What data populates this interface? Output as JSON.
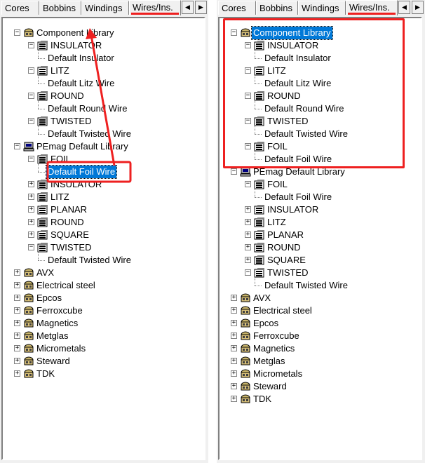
{
  "tabs": [
    {
      "label": "Cores",
      "active": false
    },
    {
      "label": "Bobbins",
      "active": false
    },
    {
      "label": "Windings",
      "active": false
    },
    {
      "label": "Wires/Ins.",
      "active": true
    }
  ],
  "icons": {
    "scroll_left": "scroll-left-arrow",
    "scroll_right": "scroll-right-arrow"
  },
  "colors": {
    "highlight": "#ee2020",
    "selection": "#0078d7"
  },
  "left_tree": [
    {
      "level": 0,
      "label": "Component Library",
      "icon": "library-icon",
      "toggle": "-"
    },
    {
      "level": 1,
      "label": "INSULATOR",
      "icon": "folder-icon",
      "toggle": "-"
    },
    {
      "level": 2,
      "label": "Default Insulator"
    },
    {
      "level": 1,
      "label": "LITZ",
      "icon": "folder-icon",
      "toggle": "-"
    },
    {
      "level": 2,
      "label": "Default Litz Wire"
    },
    {
      "level": 1,
      "label": "ROUND",
      "icon": "folder-icon",
      "toggle": "-"
    },
    {
      "level": 2,
      "label": "Default Round Wire"
    },
    {
      "level": 1,
      "label": "TWISTED",
      "icon": "folder-icon",
      "toggle": "-"
    },
    {
      "level": 2,
      "label": "Default Twisted Wire"
    },
    {
      "level": 0,
      "label": "PEmag Default Library",
      "icon": "computer-icon",
      "toggle": "-"
    },
    {
      "level": 1,
      "label": "FOIL",
      "icon": "folder-icon",
      "toggle": "-"
    },
    {
      "level": 2,
      "label": "Default Foil Wire",
      "selected": true
    },
    {
      "level": 1,
      "label": "INSULATOR",
      "icon": "folder-icon",
      "toggle": "+"
    },
    {
      "level": 1,
      "label": "LITZ",
      "icon": "folder-icon",
      "toggle": "+"
    },
    {
      "level": 1,
      "label": "PLANAR",
      "icon": "folder-icon",
      "toggle": "+"
    },
    {
      "level": 1,
      "label": "ROUND",
      "icon": "folder-icon",
      "toggle": "+"
    },
    {
      "level": 1,
      "label": "SQUARE",
      "icon": "folder-icon",
      "toggle": "+"
    },
    {
      "level": 1,
      "label": "TWISTED",
      "icon": "folder-icon",
      "toggle": "-"
    },
    {
      "level": 2,
      "label": "Default Twisted Wire"
    },
    {
      "level": 0,
      "label": "AVX",
      "icon": "library-icon",
      "toggle": "+"
    },
    {
      "level": 0,
      "label": "Electrical steel",
      "icon": "library-icon",
      "toggle": "+"
    },
    {
      "level": 0,
      "label": "Epcos",
      "icon": "library-icon",
      "toggle": "+"
    },
    {
      "level": 0,
      "label": "Ferroxcube",
      "icon": "library-icon",
      "toggle": "+"
    },
    {
      "level": 0,
      "label": "Magnetics",
      "icon": "library-icon",
      "toggle": "+"
    },
    {
      "level": 0,
      "label": "Metglas",
      "icon": "library-icon",
      "toggle": "+"
    },
    {
      "level": 0,
      "label": "Micrometals",
      "icon": "library-icon",
      "toggle": "+"
    },
    {
      "level": 0,
      "label": "Steward",
      "icon": "library-icon",
      "toggle": "+"
    },
    {
      "level": 0,
      "label": "TDK",
      "icon": "library-icon",
      "toggle": "+"
    }
  ],
  "right_tree": [
    {
      "level": 0,
      "label": "Component Library",
      "icon": "library-icon",
      "toggle": "-",
      "selected": true
    },
    {
      "level": 1,
      "label": "INSULATOR",
      "icon": "folder-icon",
      "toggle": "-"
    },
    {
      "level": 2,
      "label": "Default Insulator"
    },
    {
      "level": 1,
      "label": "LITZ",
      "icon": "folder-icon",
      "toggle": "-"
    },
    {
      "level": 2,
      "label": "Default Litz Wire"
    },
    {
      "level": 1,
      "label": "ROUND",
      "icon": "folder-icon",
      "toggle": "-"
    },
    {
      "level": 2,
      "label": "Default Round Wire"
    },
    {
      "level": 1,
      "label": "TWISTED",
      "icon": "folder-icon",
      "toggle": "-"
    },
    {
      "level": 2,
      "label": "Default Twisted Wire"
    },
    {
      "level": 1,
      "label": "FOIL",
      "icon": "folder-icon",
      "toggle": "-"
    },
    {
      "level": 2,
      "label": "Default Foil Wire"
    },
    {
      "level": 0,
      "label": "PEmag Default Library",
      "icon": "computer-icon",
      "toggle": "-"
    },
    {
      "level": 1,
      "label": "FOIL",
      "icon": "folder-icon",
      "toggle": "-"
    },
    {
      "level": 2,
      "label": "Default Foil Wire"
    },
    {
      "level": 1,
      "label": "INSULATOR",
      "icon": "folder-icon",
      "toggle": "+"
    },
    {
      "level": 1,
      "label": "LITZ",
      "icon": "folder-icon",
      "toggle": "+"
    },
    {
      "level": 1,
      "label": "PLANAR",
      "icon": "folder-icon",
      "toggle": "+"
    },
    {
      "level": 1,
      "label": "ROUND",
      "icon": "folder-icon",
      "toggle": "+"
    },
    {
      "level": 1,
      "label": "SQUARE",
      "icon": "folder-icon",
      "toggle": "+"
    },
    {
      "level": 1,
      "label": "TWISTED",
      "icon": "folder-icon",
      "toggle": "-"
    },
    {
      "level": 2,
      "label": "Default Twisted Wire"
    },
    {
      "level": 0,
      "label": "AVX",
      "icon": "library-icon",
      "toggle": "+"
    },
    {
      "level": 0,
      "label": "Electrical steel",
      "icon": "library-icon",
      "toggle": "+"
    },
    {
      "level": 0,
      "label": "Epcos",
      "icon": "library-icon",
      "toggle": "+"
    },
    {
      "level": 0,
      "label": "Ferroxcube",
      "icon": "library-icon",
      "toggle": "+"
    },
    {
      "level": 0,
      "label": "Magnetics",
      "icon": "library-icon",
      "toggle": "+"
    },
    {
      "level": 0,
      "label": "Metglas",
      "icon": "library-icon",
      "toggle": "+"
    },
    {
      "level": 0,
      "label": "Micrometals",
      "icon": "library-icon",
      "toggle": "+"
    },
    {
      "level": 0,
      "label": "Steward",
      "icon": "library-icon",
      "toggle": "+"
    },
    {
      "level": 0,
      "label": "TDK",
      "icon": "library-icon",
      "toggle": "+"
    }
  ]
}
